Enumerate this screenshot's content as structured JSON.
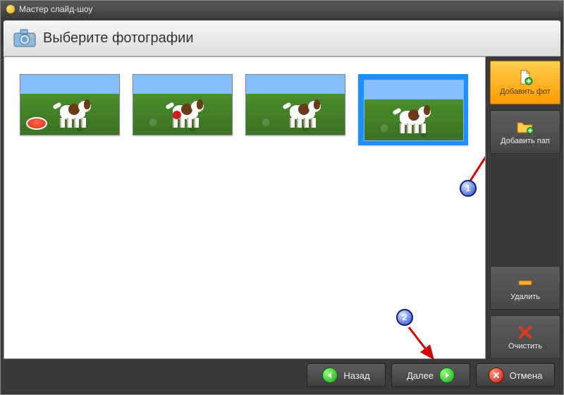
{
  "window": {
    "title": "Мастер слайд-шоу"
  },
  "header": {
    "title": "Выберите фотографии"
  },
  "thumbs": [
    {
      "id": "photo-1",
      "selected": false,
      "variant": "disc"
    },
    {
      "id": "photo-2",
      "selected": false,
      "variant": "ball"
    },
    {
      "id": "photo-3",
      "selected": false,
      "variant": "plain"
    },
    {
      "id": "photo-4",
      "selected": true,
      "variant": "leash"
    }
  ],
  "sidebar": {
    "add_photo": {
      "label": "Добавить фот",
      "icon": "file-add-icon"
    },
    "add_folder": {
      "label": "Добавить пап",
      "icon": "folder-add-icon"
    },
    "remove": {
      "label": "Удалить",
      "icon": "minus-icon"
    },
    "clear": {
      "label": "Очистить",
      "icon": "x-icon"
    }
  },
  "footer": {
    "back": {
      "label": "Назад"
    },
    "next": {
      "label": "Далее"
    },
    "cancel": {
      "label": "Отмена"
    }
  },
  "annotations": {
    "badge1": "1",
    "badge2": "2"
  },
  "colors": {
    "selection": "#1e90ff",
    "primary_grad_top": "#ffcf4d",
    "primary_grad_bot": "#ff9a00",
    "green": "#1fa31f",
    "red": "#c81a1a"
  }
}
